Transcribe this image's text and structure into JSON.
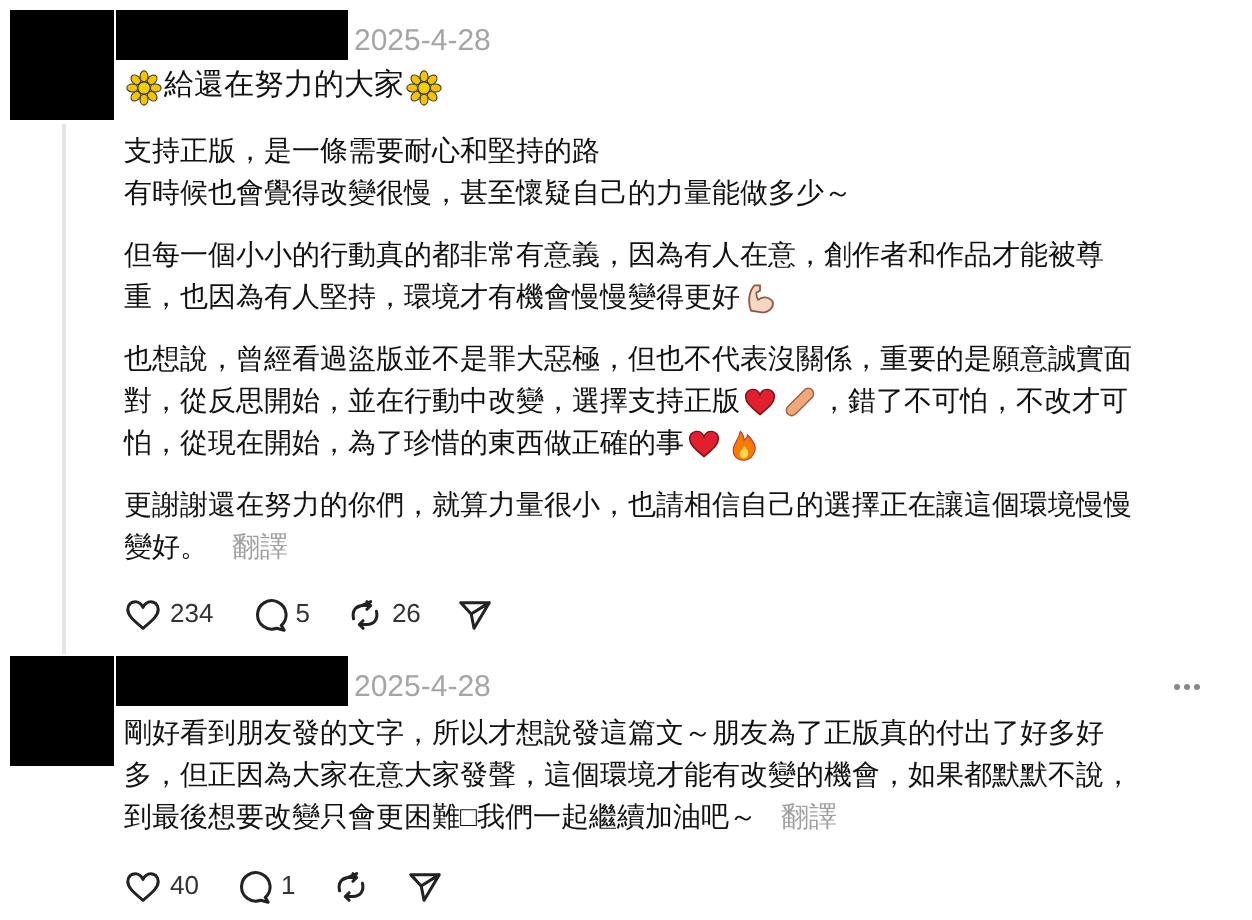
{
  "posts": [
    {
      "date": "2025-4-28",
      "more_menu": false,
      "title": [
        {
          "kind": "flower"
        },
        {
          "kind": "text",
          "text": "給還在努力的大家"
        },
        {
          "kind": "flower"
        }
      ],
      "paragraphs": [
        [
          [
            {
              "kind": "text",
              "text": "支持正版，是一條需要耐心和堅持的路"
            }
          ],
          [
            {
              "kind": "text",
              "text": "有時候也會覺得改變很慢，甚至懷疑自己的力量能做多少～"
            }
          ]
        ],
        [
          [
            {
              "kind": "text",
              "text": "但每一個小小的行動真的都非常有意義，因為有人在意，創作者和作品才能被尊"
            }
          ],
          [
            {
              "kind": "text",
              "text": "重，也因為有人堅持，環境才有機會慢慢變得更好"
            },
            {
              "kind": "biceps"
            }
          ]
        ],
        [
          [
            {
              "kind": "text",
              "text": "也想說，曾經看過盜版並不是罪大惡極，但也不代表沒關係，重要的是願意誠實面"
            }
          ],
          [
            {
              "kind": "text",
              "text": "對，從反思開始，並在行動中改變，選擇支持正版"
            },
            {
              "kind": "heart"
            },
            {
              "kind": "bandage"
            },
            {
              "kind": "text",
              "text": "，錯了不可怕，不改才可"
            }
          ],
          [
            {
              "kind": "text",
              "text": "怕，從現在開始，為了珍惜的東西做正確的事"
            },
            {
              "kind": "heart"
            },
            {
              "kind": "fire"
            }
          ]
        ],
        [
          [
            {
              "kind": "text",
              "text": "更謝謝還在努力的你們，就算力量很小，也請相信自己的選擇正在讓這個環境慢慢"
            }
          ],
          [
            {
              "kind": "text",
              "text": "變好。"
            },
            {
              "kind": "translate",
              "text": "翻譯"
            }
          ]
        ]
      ],
      "actions": [
        {
          "kind": "like",
          "count": "234"
        },
        {
          "kind": "comment",
          "count": "5"
        },
        {
          "kind": "repost",
          "count": "26"
        },
        {
          "kind": "share"
        }
      ]
    },
    {
      "date": "2025-4-28",
      "more_menu": true,
      "paragraphs": [
        [
          [
            {
              "kind": "text",
              "text": "剛好看到朋友發的文字，所以才想說發這篇文～朋友為了正版真的付出了好多好"
            }
          ],
          [
            {
              "kind": "text",
              "text": "多，但正因為大家在意大家發聲，這個環境才能有改變的機會，如果都默默不說，"
            }
          ],
          [
            {
              "kind": "text",
              "text": "到最後想要改變只會更困難□我們一起繼續加油吧～"
            },
            {
              "kind": "translate",
              "text": "翻譯"
            }
          ]
        ]
      ],
      "actions": [
        {
          "kind": "like",
          "count": "40"
        },
        {
          "kind": "comment",
          "count": "1"
        },
        {
          "kind": "repost"
        },
        {
          "kind": "share"
        }
      ]
    }
  ]
}
